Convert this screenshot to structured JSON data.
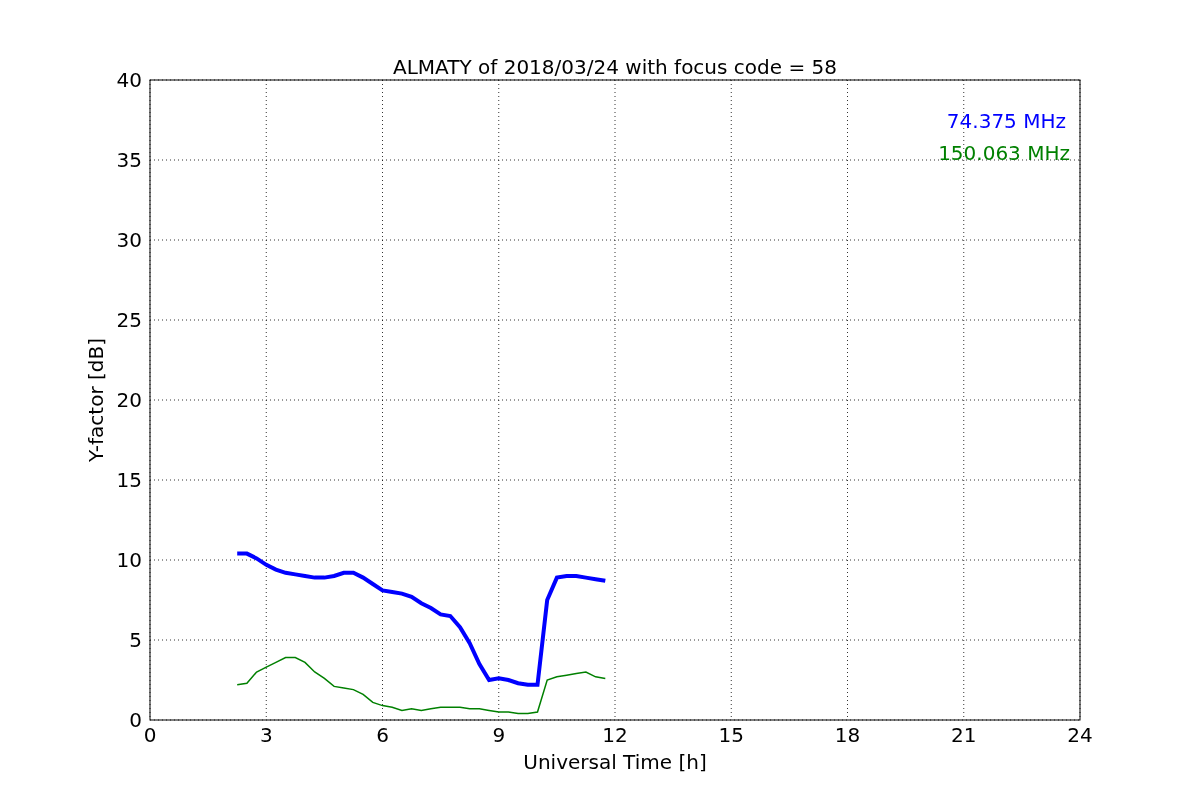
{
  "chart_data": {
    "type": "line",
    "title": "ALMATY of 2018/03/24 with focus code = 58",
    "xlabel": "Universal Time [h]",
    "ylabel": "Y-factor [dB]",
    "x": [
      2.25,
      2.5,
      2.75,
      3,
      3.25,
      3.5,
      3.75,
      4,
      4.25,
      4.5,
      4.75,
      5,
      5.25,
      5.5,
      5.75,
      6,
      6.25,
      6.5,
      6.75,
      7,
      7.25,
      7.5,
      7.75,
      8,
      8.25,
      8.5,
      8.75,
      9,
      9.25,
      9.5,
      9.75,
      10,
      10.25,
      10.5,
      10.75,
      11,
      11.25,
      11.5,
      11.75
    ],
    "series": [
      {
        "name": "74.375 MHz",
        "color": "#0000ff",
        "values": [
          10.4,
          10.4,
          10.1,
          9.7,
          9.4,
          9.2,
          9.1,
          9.0,
          8.9,
          8.9,
          9.0,
          9.2,
          9.2,
          8.9,
          8.5,
          8.1,
          8.0,
          7.9,
          7.7,
          7.3,
          7.0,
          6.6,
          6.5,
          5.8,
          4.8,
          3.5,
          2.5,
          2.6,
          2.5,
          2.3,
          2.2,
          2.2,
          7.5,
          8.9,
          9.0,
          9.0,
          8.9,
          8.8,
          8.7
        ]
      },
      {
        "name": "150.063 MHz",
        "color": "#008000",
        "values": [
          2.2,
          2.3,
          3.0,
          3.3,
          3.6,
          3.9,
          3.9,
          3.6,
          3.0,
          2.6,
          2.1,
          2.0,
          1.9,
          1.6,
          1.1,
          0.9,
          0.8,
          0.6,
          0.7,
          0.6,
          0.7,
          0.8,
          0.8,
          0.8,
          0.7,
          0.7,
          0.6,
          0.5,
          0.5,
          0.4,
          0.4,
          0.5,
          2.5,
          2.7,
          2.8,
          2.9,
          3.0,
          2.7,
          2.6
        ]
      }
    ],
    "xlim": [
      0,
      24
    ],
    "ylim": [
      0,
      40
    ],
    "xticks": [
      0,
      3,
      6,
      9,
      12,
      15,
      18,
      21,
      24
    ],
    "yticks": [
      0,
      5,
      10,
      15,
      20,
      25,
      30,
      35,
      40
    ],
    "grid": true
  }
}
